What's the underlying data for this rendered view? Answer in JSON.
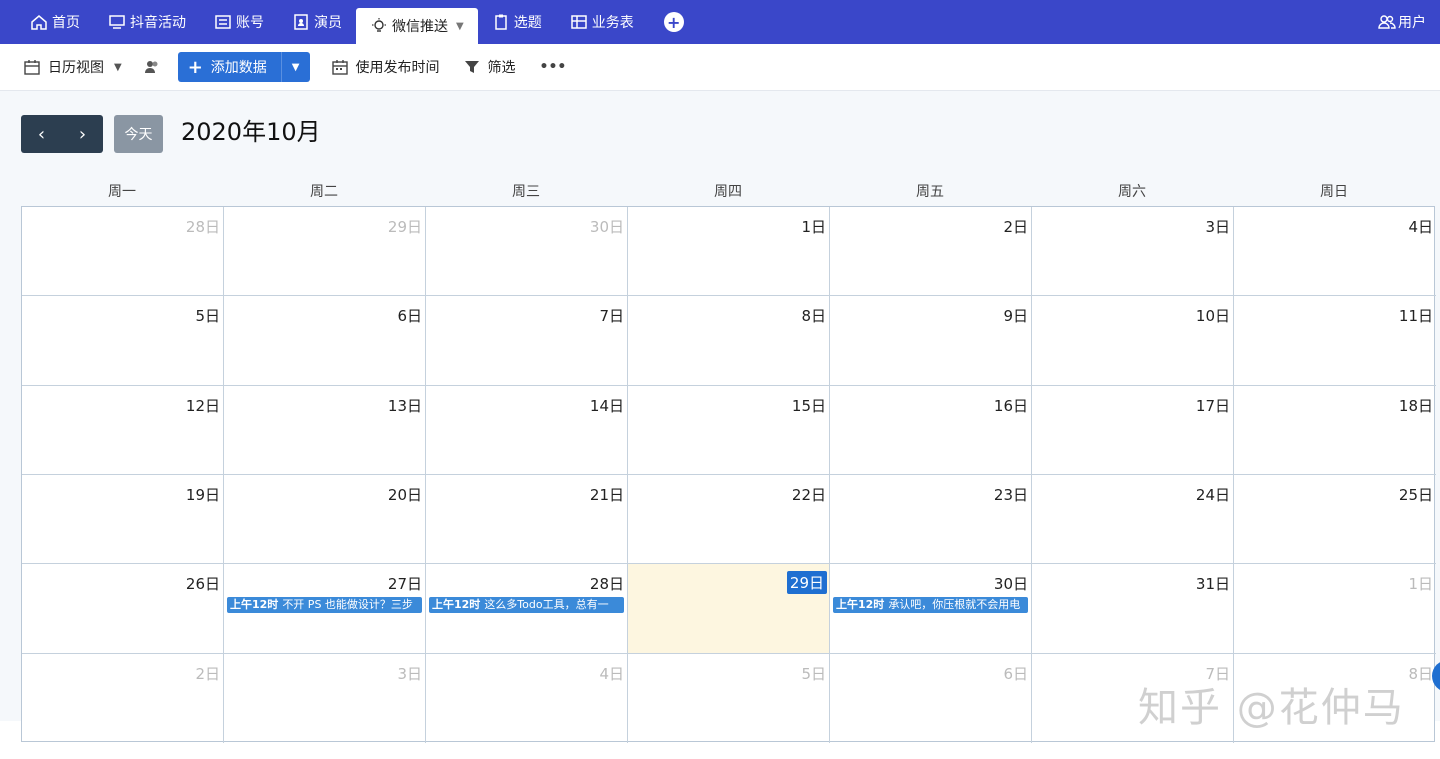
{
  "tabs": [
    {
      "label": "首页",
      "icon": "home-icon"
    },
    {
      "label": "抖音活动",
      "icon": "monitor-icon"
    },
    {
      "label": "账号",
      "icon": "list-icon"
    },
    {
      "label": "演员",
      "icon": "contact-icon"
    },
    {
      "label": "微信推送",
      "icon": "lightbulb-icon",
      "active": true
    },
    {
      "label": "选题",
      "icon": "clipboard-icon"
    },
    {
      "label": "业务表",
      "icon": "table-icon"
    }
  ],
  "user_label": "用户",
  "toolbar": {
    "view_label": "日历视图",
    "add_label": "添加数据",
    "date_field_label": "使用发布时间",
    "filter_label": "筛选",
    "more_label": "•••"
  },
  "calendar": {
    "today_label": "今天",
    "title": "2020年10月",
    "weekdays": [
      "周一",
      "周二",
      "周三",
      "周四",
      "周五",
      "周六",
      "周日"
    ],
    "weeks": [
      [
        {
          "d": "28日",
          "o": true
        },
        {
          "d": "29日",
          "o": true
        },
        {
          "d": "30日",
          "o": true
        },
        {
          "d": "1日"
        },
        {
          "d": "2日"
        },
        {
          "d": "3日"
        },
        {
          "d": "4日"
        }
      ],
      [
        {
          "d": "5日"
        },
        {
          "d": "6日"
        },
        {
          "d": "7日"
        },
        {
          "d": "8日"
        },
        {
          "d": "9日"
        },
        {
          "d": "10日"
        },
        {
          "d": "11日"
        }
      ],
      [
        {
          "d": "12日"
        },
        {
          "d": "13日"
        },
        {
          "d": "14日"
        },
        {
          "d": "15日"
        },
        {
          "d": "16日"
        },
        {
          "d": "17日"
        },
        {
          "d": "18日"
        }
      ],
      [
        {
          "d": "19日"
        },
        {
          "d": "20日"
        },
        {
          "d": "21日"
        },
        {
          "d": "22日"
        },
        {
          "d": "23日"
        },
        {
          "d": "24日"
        },
        {
          "d": "25日"
        }
      ],
      [
        {
          "d": "26日"
        },
        {
          "d": "27日",
          "evtTime": "上午12时",
          "evtText": "不开 PS 也能做设计？三步"
        },
        {
          "d": "28日",
          "evtTime": "上午12时",
          "evtText": "这么多Todo工具，总有一"
        },
        {
          "d": "29日",
          "today": true
        },
        {
          "d": "30日",
          "evtTime": "上午12时",
          "evtText": "承认吧，你压根就不会用电"
        },
        {
          "d": "31日"
        },
        {
          "d": "1日",
          "o": true
        }
      ],
      [
        {
          "d": "2日",
          "o": true
        },
        {
          "d": "3日",
          "o": true
        },
        {
          "d": "4日",
          "o": true
        },
        {
          "d": "5日",
          "o": true
        },
        {
          "d": "6日",
          "o": true
        },
        {
          "d": "7日",
          "o": true
        },
        {
          "d": "8日",
          "o": true
        }
      ]
    ]
  },
  "watermark": "知乎 @花仲马",
  "colors": {
    "topbar": "#3a47c9",
    "accent": "#2a6fd6",
    "event": "#3b8ad9",
    "today_cell": "#fdf6e0"
  }
}
